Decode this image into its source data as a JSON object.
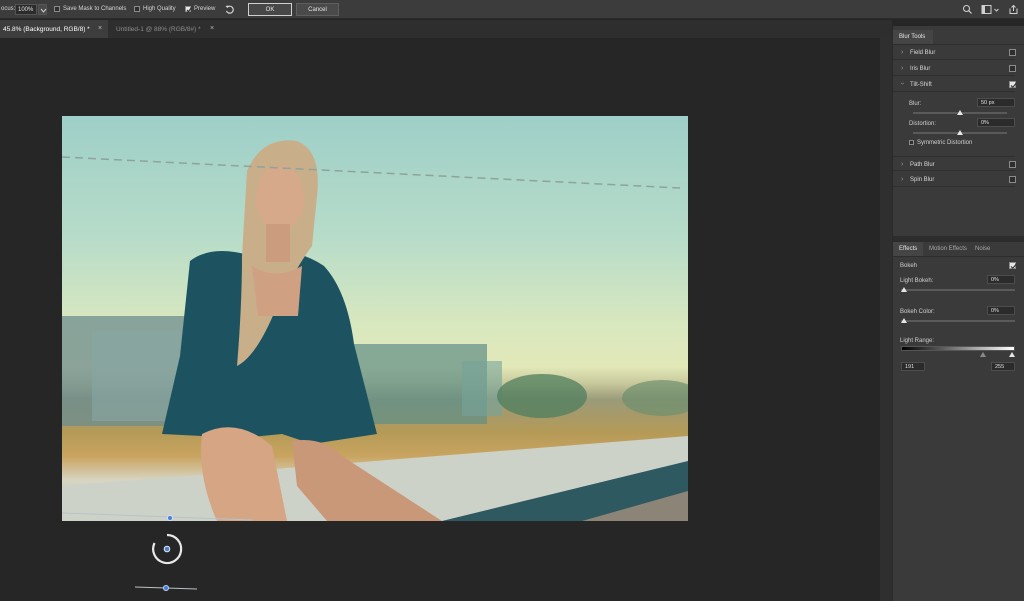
{
  "optionsbar": {
    "focus_label": "ocus:",
    "focus_value": "100%",
    "save_mask_label": "Save Mask to Channels",
    "save_mask_checked": false,
    "high_quality_label": "High Quality",
    "high_quality_checked": false,
    "preview_label": "Preview",
    "preview_checked": true,
    "ok_label": "OK",
    "cancel_label": "Cancel",
    "icons": [
      "reset-icon",
      "search-icon",
      "workspace-icon",
      "share-icon"
    ]
  },
  "tabs": [
    {
      "label": "45.8% (Background, RGB/8) *",
      "active": true
    },
    {
      "label": "Untitled-1 @ 88% (RGB/8#) *",
      "active": false
    }
  ],
  "blur_tools": {
    "title": "Blur Tools",
    "items": [
      {
        "label": "Field Blur",
        "expanded": false,
        "checked": false
      },
      {
        "label": "Iris Blur",
        "expanded": false,
        "checked": false
      },
      {
        "label": "Tilt-Shift",
        "expanded": true,
        "checked": true
      },
      {
        "label": "Path Blur",
        "expanded": false,
        "checked": false
      },
      {
        "label": "Spin Blur",
        "expanded": false,
        "checked": false
      }
    ],
    "tilt_shift": {
      "blur_label": "Blur:",
      "blur_value": "50 px",
      "blur_level": 0.5,
      "distortion_label": "Distortion:",
      "distortion_value": "0%",
      "distortion_level": 0.5,
      "symmetric_label": "Symmetric Distortion",
      "symmetric_checked": false
    }
  },
  "effects": {
    "tabs": [
      "Effects",
      "Motion Effects",
      "Noise"
    ],
    "active_tab": "Effects",
    "bokeh_label": "Bokeh",
    "bokeh_checked": true,
    "light_bokeh_label": "Light Bokeh:",
    "light_bokeh_value": "0%",
    "bokeh_color_label": "Bokeh Color:",
    "bokeh_color_value": "0%",
    "light_range_label": "Light Range:",
    "light_range_low": "191",
    "light_range_high": "255"
  },
  "colors": {
    "accent_pin": "#4a7fd6",
    "panel_bg": "#3a3a3a",
    "canvas_bg": "#262626"
  }
}
